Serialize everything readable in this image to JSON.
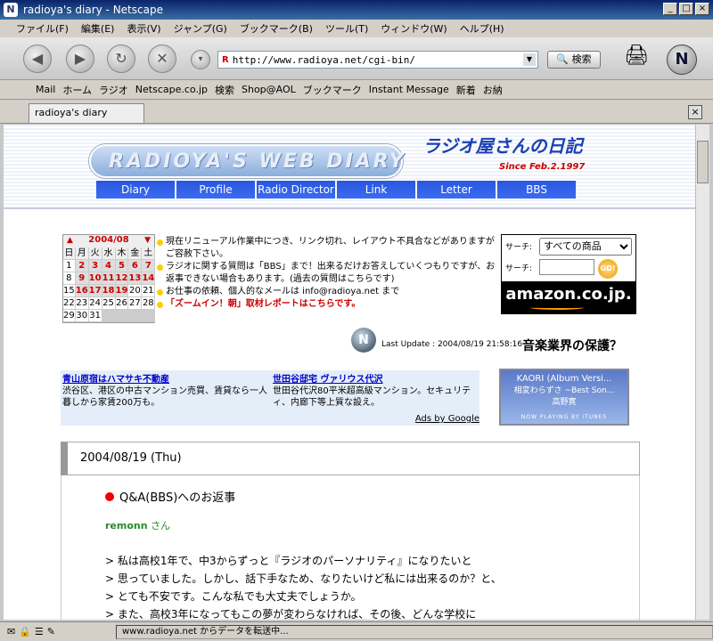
{
  "window": {
    "title": "radioya's diary - Netscape"
  },
  "menu": [
    "ファイル(F)",
    "編集(E)",
    "表示(V)",
    "ジャンプ(G)",
    "ブックマーク(B)",
    "ツール(T)",
    "ウィンドウ(W)",
    "ヘルプ(H)"
  ],
  "nav": {
    "url": "http://www.radioya.net/cgi-bin/",
    "search_label": "検索"
  },
  "bookmarks": [
    "Mail",
    "ホーム",
    "ラジオ",
    "Netscape.co.jp",
    "検索",
    "Shop@AOL",
    "ブックマーク",
    "Instant Message",
    "新着",
    "お納"
  ],
  "tab": {
    "label": "radioya's diary"
  },
  "status": {
    "message": "www.radioya.net からデータを転送中..."
  },
  "site": {
    "logo": "RADIOYA'S WEB DIARY",
    "title": "ラジオ屋さんの日記",
    "since": "Since Feb.2.1997",
    "nav": [
      "Diary",
      "Profile",
      "Radio Director",
      "Link",
      "Letter",
      "BBS"
    ]
  },
  "calendar": {
    "month": "2004/08",
    "days_of_week": [
      "日",
      "月",
      "火",
      "水",
      "木",
      "金",
      "土"
    ],
    "cells": [
      "1",
      "2",
      "3",
      "4",
      "5",
      "6",
      "7",
      "8",
      "9",
      "10",
      "11",
      "12",
      "13",
      "14",
      "15",
      "16",
      "17",
      "18",
      "19",
      "20",
      "21",
      "22",
      "23",
      "24",
      "25",
      "26",
      "27",
      "28",
      "29",
      "30",
      "31",
      "",
      "",
      "",
      ""
    ],
    "linked_days": [
      "2",
      "3",
      "4",
      "5",
      "6",
      "7",
      "9",
      "10",
      "11",
      "12",
      "13",
      "14",
      "16",
      "17",
      "18",
      "19"
    ]
  },
  "notices": [
    "現在リニューアル作業中につき、リンク切れ、レイアウト不具合などがありますがご容赦下さい。",
    "ラジオに関する質問は「BBS」まで！出来るだけお答えしていくつもりですが、お返事できない場合もあります。(過去の質問はこちらです)",
    "お仕事の依頼、個人的なメールは info@radioya.net まで",
    "「ズームイン！朝」取材レポートはこちらです。"
  ],
  "amazon": {
    "search_label": "サーチ:",
    "category": "すべての商品",
    "go": "GO!",
    "brand": "amazon.co.jp."
  },
  "update": {
    "text": "Last Update : 2004/08/19 21:58:16",
    "headline": "音楽業界の保護？"
  },
  "ads": [
    {
      "title": "青山原宿はハマサキ不動産",
      "body": "渋谷区、港区の中古マンション売買、賃貸なら一人暮しから家賃200万も。"
    },
    {
      "title": "世田谷邸宅 ヴァリウス代沢",
      "body": "世田谷代沢80平米超高級マンション。セキュリティ、内廊下等上質な設え。"
    }
  ],
  "ads_by": "Ads by Google",
  "itunes": {
    "line1": "KAORI (Album Versi...",
    "line2": "相変わらずさ ~Best Son...",
    "line3": "高野寛",
    "np": "NOW PLAYING BY iTUNES"
  },
  "entry": {
    "date": "2004/08/19 (Thu)",
    "heading": "Q&A(BBS)へのお返事",
    "author": "remonn",
    "author_suffix": " さん",
    "quote": [
      "> 私は高校1年で、中3からずっと『ラジオのパーソナリティ』になりたいと",
      "> 思っていました。しかし、話下手なため、なりたいけど私には出来るのか？と、",
      "> とても不安です。こんな私でも大丈夫でしょうか。",
      "> また、高校3年になってもこの夢が変わらなければ、その後、どんな学校に"
    ]
  }
}
